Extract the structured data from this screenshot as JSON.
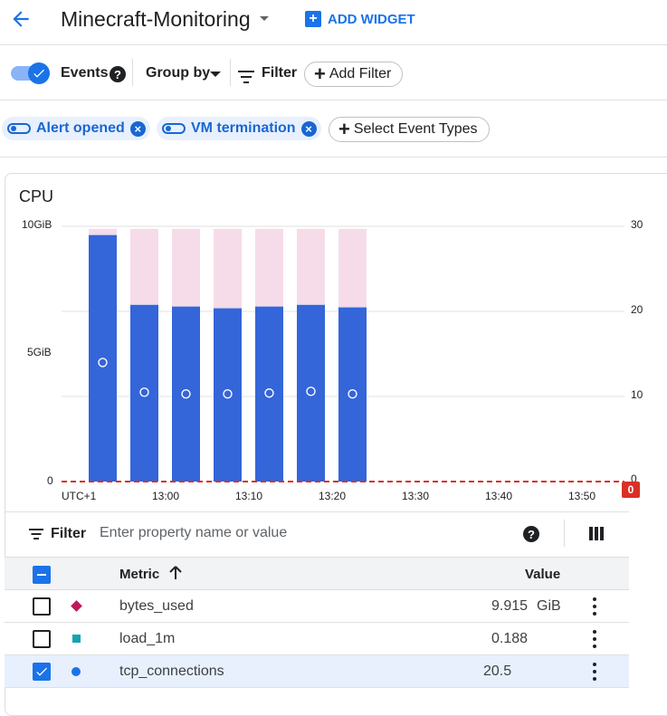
{
  "header": {
    "title": "Minecraft-Monitoring",
    "add_widget": "ADD WIDGET"
  },
  "toolbar": {
    "events_label": "Events",
    "events_enabled": true,
    "group_by_label": "Group by",
    "filter_label": "Filter",
    "add_filter_label": "Add Filter"
  },
  "event_chips": [
    {
      "label": "Alert opened"
    },
    {
      "label": "VM termination"
    }
  ],
  "select_event_types_label": "Select Event Types",
  "chart": {
    "title": "CPU",
    "left_ticks": [
      "10GiB",
      "5GiB",
      "0"
    ],
    "right_ticks": [
      "30",
      "20",
      "10",
      "0"
    ],
    "x_ticks": [
      "UTC+1",
      "13:00",
      "13:10",
      "13:20",
      "13:30",
      "13:40",
      "13:50"
    ],
    "event_count_badge": "0",
    "colors": {
      "bar": "#3465d9",
      "bar_background": "#f6dce9",
      "threshold": "#d93025"
    }
  },
  "chart_data": {
    "type": "bar",
    "title": "CPU",
    "x_ticks": [
      "UTC+1",
      "13:00",
      "13:10",
      "13:20",
      "13:30",
      "13:40",
      "13:50"
    ],
    "series": [
      {
        "name": "bytes_used",
        "axis": "left",
        "unit": "GiB",
        "values": [
          9.9,
          9.9,
          9.9,
          9.9,
          9.9,
          9.9,
          9.9
        ]
      },
      {
        "name": "tcp_connections",
        "axis": "right",
        "values": [
          29,
          20.8,
          20.6,
          20.4,
          20.6,
          20.8,
          20.5
        ]
      },
      {
        "name": "load_1m",
        "axis": "right",
        "values": [
          14,
          10.5,
          10.3,
          10.3,
          10.4,
          10.6,
          10.3
        ]
      }
    ],
    "ylim_left": [
      0,
      10
    ],
    "ylim_right": [
      0,
      30
    ],
    "grid": true
  },
  "table": {
    "filter_label": "Filter",
    "filter_placeholder": "Enter property name or value",
    "columns": {
      "metric": "Metric",
      "value": "Value"
    },
    "rows": [
      {
        "metric": "bytes_used",
        "value": "9.915",
        "unit": "GiB",
        "selected": false,
        "legend_shape": "diamond",
        "legend_color": "#c2185b"
      },
      {
        "metric": "load_1m",
        "value": "0.188",
        "unit": "",
        "selected": false,
        "legend_shape": "square",
        "legend_color": "#12a4af"
      },
      {
        "metric": "tcp_connections",
        "value": "20.5",
        "unit": "",
        "selected": true,
        "legend_shape": "circle",
        "legend_color": "#1a73e8"
      }
    ]
  }
}
